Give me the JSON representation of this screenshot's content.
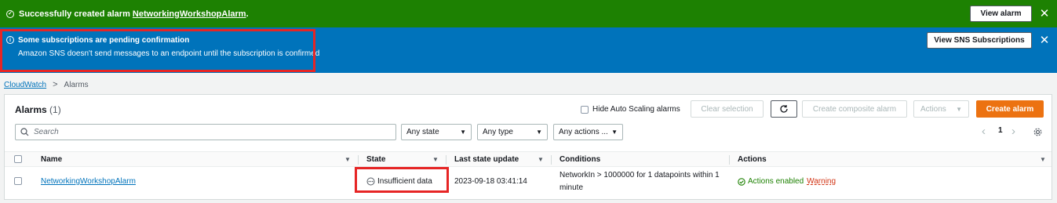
{
  "flash_success": {
    "message_prefix": "Successfully created alarm ",
    "alarm_link": "NetworkingWorkshopAlarm",
    "message_suffix": ".",
    "button": "View alarm",
    "close": "✕"
  },
  "flash_info": {
    "title": "Some subscriptions are pending confirmation",
    "body": "Amazon SNS doesn't send messages to an endpoint until the subscription is confirmed",
    "button": "View SNS Subscriptions",
    "close": "✕"
  },
  "breadcrumb": {
    "root": "CloudWatch",
    "separator": ">",
    "current": "Alarms"
  },
  "panel": {
    "title": "Alarms",
    "count": "(1)",
    "hide_autoscaling": "Hide Auto Scaling alarms",
    "buttons": {
      "clear_selection": "Clear selection",
      "create_composite": "Create composite alarm",
      "actions": "Actions",
      "create_alarm": "Create alarm"
    },
    "search_placeholder": "Search",
    "filters": {
      "state": "Any state",
      "type": "Any type",
      "actions": "Any actions ..."
    },
    "pagination": {
      "prev": "‹",
      "page": "1",
      "next": "›"
    }
  },
  "table": {
    "columns": [
      "Name",
      "State",
      "Last state update",
      "Conditions",
      "Actions"
    ],
    "rows": [
      {
        "name": "NetworkingWorkshopAlarm",
        "state": "Insufficient data",
        "last_update": "2023-09-18 03:41:14",
        "conditions_line1": "NetworkIn > 1000000 for 1 datapoints within 1",
        "conditions_line2": "minute",
        "actions_enabled": "Actions enabled",
        "actions_warning": "Warning"
      }
    ]
  },
  "colors": {
    "success": "#1d8102",
    "info": "#0073bb",
    "primary": "#ec7211",
    "highlight": "#e62525"
  }
}
